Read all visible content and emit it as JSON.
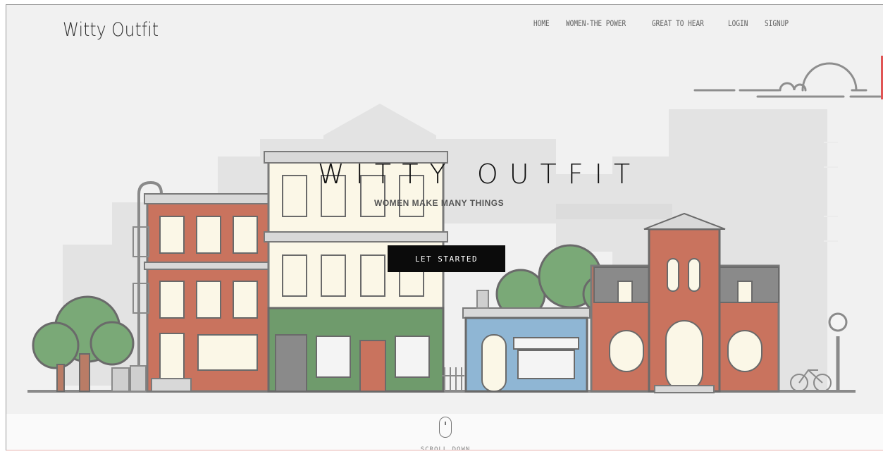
{
  "header": {
    "logo": "Witty Outfit",
    "nav": [
      {
        "label": "HOME"
      },
      {
        "label": "WOMEN-THE POWER"
      },
      {
        "label": "GREAT TO HEAR"
      },
      {
        "label": "LOGIN"
      },
      {
        "label": "SIGNUP"
      }
    ]
  },
  "hero": {
    "title": "WITTY OUTFIT",
    "subtitle": "WOMEN MAKE MANY THINGS",
    "cta_label": "LET STARTED"
  },
  "footer": {
    "scroll_label": "SCROLL DOWN",
    "scroll_icon": "mouse-icon"
  },
  "colors": {
    "background": "#f1f1f1",
    "brick": "#c9735e",
    "cream": "#fbf7e7",
    "green": "#6f9b6c",
    "tree": "#7aa977",
    "blue_shop": "#8fb6d4",
    "outline": "#8a8a8a",
    "cta_bg": "#0b0b0b",
    "accent_red": "#e05454"
  }
}
